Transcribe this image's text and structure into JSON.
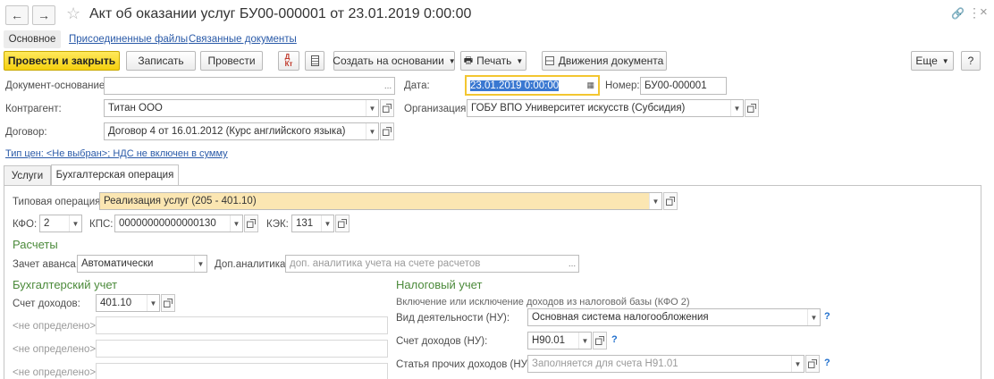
{
  "window": {
    "title": "Акт об оказании услуг БУ00-000001 от 23.01.2019 0:00:00"
  },
  "nav_tabs": [
    {
      "label": "Основное"
    },
    {
      "label": "Присоединенные файлы"
    },
    {
      "label": "Связанные документы"
    }
  ],
  "toolbar": {
    "post_close": "Провести и закрыть",
    "save": "Записать",
    "post": "Провести",
    "create_based": "Создать на основании",
    "print": "Печать",
    "movements": "Движения документа",
    "more": "Еще",
    "help": "?"
  },
  "header": {
    "base_doc_label": "Документ-основание:",
    "base_doc_value": "",
    "date_label": "Дата:",
    "date_value": "23.01.2019  0:00:00",
    "number_label": "Номер:",
    "number_value": "БУ00-000001",
    "counterparty_label": "Контрагент:",
    "counterparty_value": "Титан ООО",
    "organization_label": "Организация:",
    "organization_value": "ГОБУ ВПО Университет искусств (Субсидия)",
    "contract_label": "Договор:",
    "contract_value": "Договор 4 от 16.01.2012 (Курс английского языка)",
    "price_link": "Тип цен: <Не выбран>; НДС не включен в сумму"
  },
  "content_tabs": [
    {
      "label": "Услуги"
    },
    {
      "label": "Бухгалтерская операция"
    }
  ],
  "operation": {
    "typical_label": "Типовая операция:",
    "typical_value": "Реализация услуг (205 - 401.10)",
    "kfo_label": "КФО:",
    "kfo_value": "2",
    "kps_label": "КПС:",
    "kps_value": "00000000000000130",
    "kek_label": "КЭК:",
    "kek_value": "131"
  },
  "settlements": {
    "title": "Расчеты",
    "advance_label": "Зачет аванса:",
    "advance_value": "Автоматически",
    "analytics_label": "Доп.аналитика:",
    "analytics_placeholder": "доп. аналитика учета на счете расчетов"
  },
  "accounting": {
    "title": "Бухгалтерский учет",
    "income_account_label": "Счет доходов:",
    "income_account_value": "401.10",
    "undefined_rows": [
      {
        "label": "<не определено>:"
      },
      {
        "label": "<не определено>:"
      },
      {
        "label": "<не определено>:"
      }
    ]
  },
  "tax": {
    "title": "Налоговый учет",
    "subtitle": "Включение или исключение доходов из налоговой базы (КФО 2)",
    "activity_label": "Вид деятельности (НУ):",
    "activity_value": "Основная система налогообложения",
    "income_account_label": "Счет доходов (НУ):",
    "income_account_value": "Н90.01",
    "other_income_label": "Статья прочих доходов (НУ):",
    "other_income_placeholder": "Заполняется для счета Н91.01",
    "help_mark": "?"
  },
  "colors": {
    "accent_yellow": "#f5d00f",
    "section_green": "#4b8a3a",
    "link_blue": "#2a5aa8",
    "highlight_field": "#fbe6b2"
  },
  "icons": [
    "back-arrow-icon",
    "forward-arrow-icon",
    "star-icon",
    "link-icon",
    "more-vert-icon",
    "close-icon",
    "dt-kt-icon",
    "report-icon",
    "printer-icon",
    "movements-icon",
    "calendar-icon",
    "open-icon"
  ]
}
